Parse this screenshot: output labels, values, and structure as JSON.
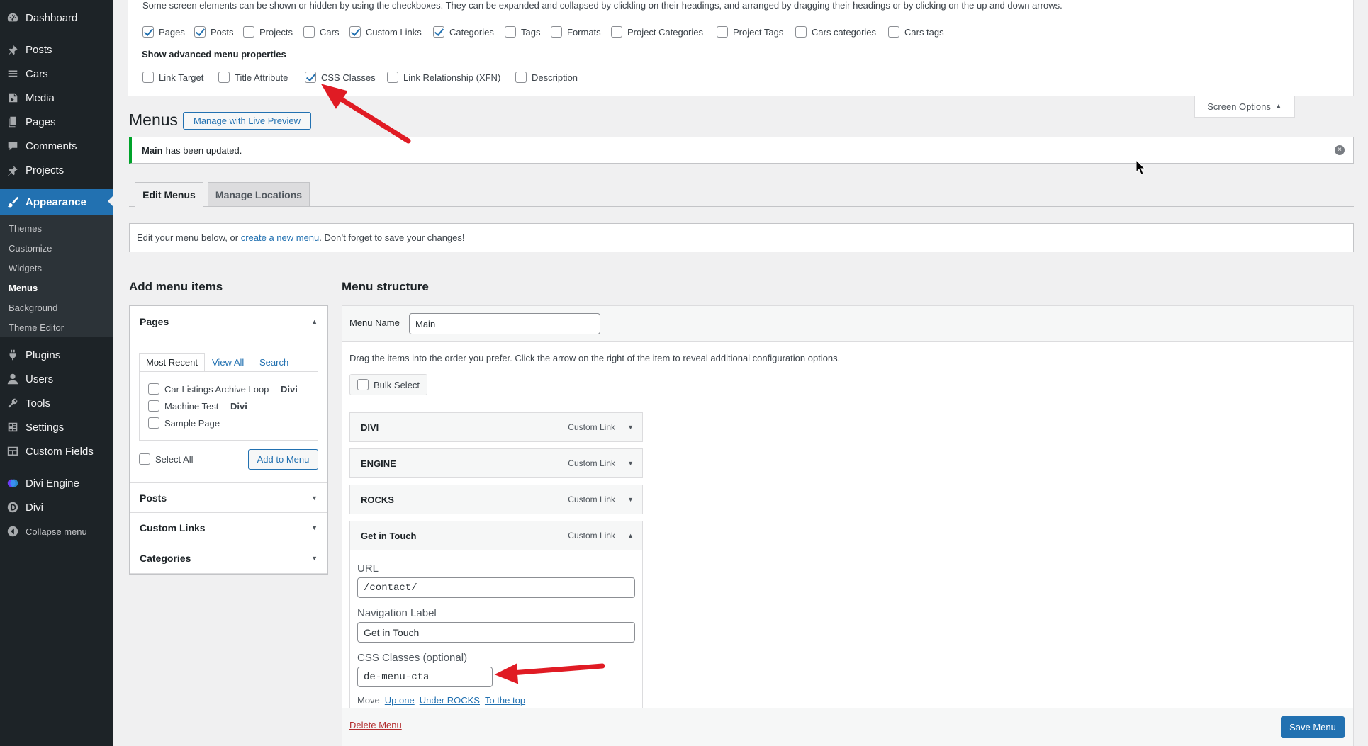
{
  "sidebar": {
    "items": [
      {
        "label": "Dashboard",
        "icon": "dashboard-icon"
      },
      {
        "label": "Posts",
        "icon": "pin-icon"
      },
      {
        "label": "Cars",
        "icon": "list-icon"
      },
      {
        "label": "Media",
        "icon": "media-icon"
      },
      {
        "label": "Pages",
        "icon": "page-icon"
      },
      {
        "label": "Comments",
        "icon": "comment-icon"
      },
      {
        "label": "Projects",
        "icon": "pin-icon"
      },
      {
        "label": "Appearance",
        "icon": "paintbrush-icon"
      },
      {
        "label": "Plugins",
        "icon": "plugin-icon"
      },
      {
        "label": "Users",
        "icon": "user-icon"
      },
      {
        "label": "Tools",
        "icon": "wrench-icon"
      },
      {
        "label": "Settings",
        "icon": "settings-icon"
      },
      {
        "label": "Custom Fields",
        "icon": "table-icon"
      },
      {
        "label": "Divi Engine",
        "icon": "divi-engine-icon"
      },
      {
        "label": "Divi",
        "icon": "divi-icon"
      },
      {
        "label": "Collapse menu",
        "icon": "collapse-icon"
      }
    ],
    "submenu": [
      "Themes",
      "Customize",
      "Widgets",
      "Menus",
      "Background",
      "Theme Editor"
    ]
  },
  "screen_options": {
    "description": "Some screen elements can be shown or hidden by using the checkboxes. They can be expanded and collapsed by clickling on their headings, and arranged by dragging their headings or by clicking on the up and down arrows.",
    "boxes": [
      {
        "label": "Pages",
        "checked": true
      },
      {
        "label": "Posts",
        "checked": true
      },
      {
        "label": "Projects",
        "checked": false
      },
      {
        "label": "Cars",
        "checked": false
      },
      {
        "label": "Custom Links",
        "checked": true
      },
      {
        "label": "Categories",
        "checked": true
      },
      {
        "label": "Tags",
        "checked": false
      },
      {
        "label": "Formats",
        "checked": false
      },
      {
        "label": "Project Categories",
        "checked": false
      },
      {
        "label": "Project Tags",
        "checked": false
      },
      {
        "label": "Cars categories",
        "checked": false
      },
      {
        "label": "Cars tags",
        "checked": false
      }
    ],
    "advanced_heading": "Show advanced menu properties",
    "advanced": [
      {
        "label": "Link Target",
        "checked": false
      },
      {
        "label": "Title Attribute",
        "checked": false
      },
      {
        "label": "CSS Classes",
        "checked": true
      },
      {
        "label": "Link Relationship (XFN)",
        "checked": false
      },
      {
        "label": "Description",
        "checked": false
      }
    ],
    "tab_label": "Screen Options"
  },
  "header": {
    "title": "Menus",
    "live_preview": "Manage with Live Preview"
  },
  "notice": {
    "bold": "Main",
    "text": "has been updated."
  },
  "tabs": [
    "Edit Menus",
    "Manage Locations"
  ],
  "edit_bar": {
    "before": "Edit your menu below, or",
    "link": "create a new menu",
    "after": ". Don’t forget to save your changes!"
  },
  "add_items": {
    "title": "Add menu items",
    "sections": [
      "Pages",
      "Posts",
      "Custom Links",
      "Categories"
    ],
    "page_tabs": [
      "Most Recent",
      "View All",
      "Search"
    ],
    "pages": [
      {
        "name": "Car Listings Archive Loop — ",
        "suffix": "Divi"
      },
      {
        "name": "Machine Test — ",
        "suffix": "Divi"
      },
      {
        "name": "Sample Page",
        "suffix": ""
      }
    ],
    "select_all": "Select All",
    "add_button": "Add to Menu"
  },
  "menu_structure": {
    "title": "Menu structure",
    "name_label": "Menu Name",
    "name_value": "Main",
    "instructions": "Drag the items into the order you prefer. Click the arrow on the right of the item to reveal additional configuration options.",
    "bulk_select": "Bulk Select",
    "items": [
      {
        "title": "DIVI",
        "type": "Custom Link"
      },
      {
        "title": "ENGINE",
        "type": "Custom Link"
      },
      {
        "title": "ROCKS",
        "type": "Custom Link"
      },
      {
        "title": "Get in Touch",
        "type": "Custom Link"
      }
    ],
    "open_item": {
      "url_label": "URL",
      "url_value": "/contact/",
      "nav_label": "Navigation Label",
      "nav_value": "Get in Touch",
      "css_label": "CSS Classes (optional)",
      "css_value": "de-menu-cta",
      "move_label": "Move",
      "move_links": [
        "Up one",
        "Under ROCKS",
        "To the top"
      ]
    },
    "delete": "Delete Menu",
    "save": "Save Menu"
  },
  "colors": {
    "accent": "#2271b1",
    "sidebar": "#1d2327",
    "success": "#00a32a",
    "annotation_arrow": "#e01b24"
  }
}
